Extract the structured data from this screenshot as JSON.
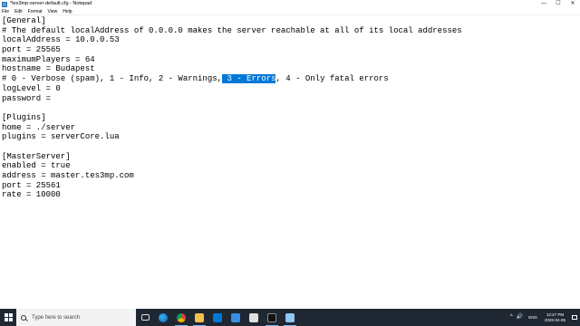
{
  "window": {
    "title": "*tes3mp-server-default.cfg - Notepad",
    "controls": {
      "minimize": "—",
      "maximize": "☐",
      "close": "✕"
    }
  },
  "menu": [
    "File",
    "Edit",
    "Format",
    "View",
    "Help"
  ],
  "editor": {
    "lines": [
      "[General]",
      "# The default localAddress of 0.0.0.0 makes the server reachable at all of its local addresses",
      "localAddress = 10.0.0.53",
      "port = 25565",
      "maximumPlayers = 64",
      "hostname = Budapest",
      {
        "before": "# 0 - Verbose (spam), 1 - Info, 2 - Warnings,",
        "selected": " 3 - Errors",
        "after": ", 4 - Only fatal errors"
      },
      "logLevel = 0",
      "password = ",
      "",
      "[Plugins]",
      "home = ./server",
      "plugins = serverCore.lua",
      "",
      "[MasterServer]",
      "enabled = true",
      "address = master.tes3mp.com",
      "port = 25561",
      "rate = 10000"
    ],
    "selection_color": "#0078d7"
  },
  "taskbar": {
    "search_placeholder": "Type here to search",
    "icons": [
      "task-view-icon",
      "edge-icon",
      "chrome-icon",
      "file-explorer-icon",
      "store-icon",
      "mail-icon",
      "unity-icon",
      "command-prompt-icon",
      "notepad-icon"
    ],
    "tray": {
      "chevron": "^",
      "volume": "🔊",
      "language": "ENG",
      "time": "12:27 PM",
      "date": "2020-04-05"
    },
    "background": "#1f2733"
  }
}
